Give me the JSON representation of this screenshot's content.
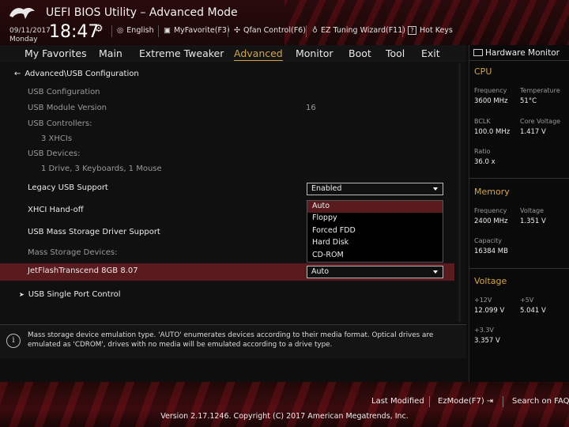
{
  "header": {
    "title": "UEFI BIOS Utility – Advanced Mode",
    "date": "09/11/2017",
    "day": "Monday",
    "time": "18:47",
    "tools": [
      {
        "label": "English",
        "icon": "globe-icon"
      },
      {
        "label": "MyFavorite(F3)",
        "icon": "favorite-icon"
      },
      {
        "label": "Qfan Control(F6)",
        "icon": "fan-icon"
      },
      {
        "label": "EZ Tuning Wizard(F11)",
        "icon": "bulb-icon"
      },
      {
        "label": "Hot Keys",
        "icon": "question-icon"
      }
    ]
  },
  "tabs": [
    {
      "label": "My Favorites"
    },
    {
      "label": "Main"
    },
    {
      "label": "Extreme Tweaker"
    },
    {
      "label": "Advanced",
      "active": true
    },
    {
      "label": "Monitor"
    },
    {
      "label": "Boot"
    },
    {
      "label": "Tool"
    },
    {
      "label": "Exit"
    }
  ],
  "breadcrumb": "Advanced\\USB Configuration",
  "main": {
    "usb_config": "USB Configuration",
    "module_version_label": "USB Module Version",
    "module_version_value": "16",
    "controllers_label": "USB Controllers:",
    "controllers_value": "3 XHCIs",
    "devices_label": "USB Devices:",
    "devices_value": "1 Drive, 3 Keyboards, 1 Mouse",
    "legacy_label": "Legacy USB Support",
    "legacy_value": "Enabled",
    "xhci_label": "XHCI Hand-off",
    "mass_driver_label": "USB Mass Storage Driver Support",
    "mass_devices_label": "Mass Storage Devices:",
    "jetflash_label": "JetFlashTranscend 8GB 8.07",
    "jetflash_value": "Auto",
    "single_port_label": "USB Single Port Control"
  },
  "popup_options": [
    "Auto",
    "Floppy",
    "Forced FDD",
    "Hard Disk",
    "CD-ROM"
  ],
  "info_text": "Mass storage device emulation type. 'AUTO' enumerates devices according to their media format. Optical drives are emulated as 'CDROM', drives with no media will be emulated according to a drive type.",
  "hardware_monitor": {
    "title": "Hardware Monitor",
    "cpu": {
      "title": "CPU",
      "frequency_label": "Frequency",
      "frequency_value": "3600 MHz",
      "temperature_label": "Temperature",
      "temperature_value": "51°C",
      "bclk_label": "BCLK",
      "bclk_value": "100.0 MHz",
      "core_voltage_label": "Core Voltage",
      "core_voltage_value": "1.417 V",
      "ratio_label": "Ratio",
      "ratio_value": "36.0 x"
    },
    "memory": {
      "title": "Memory",
      "frequency_label": "Frequency",
      "frequency_value": "2400 MHz",
      "voltage_label": "Voltage",
      "voltage_value": "1.351 V",
      "capacity_label": "Capacity",
      "capacity_value": "16384 MB"
    },
    "voltage": {
      "title": "Voltage",
      "v12_label": "+12V",
      "v12_value": "12.099 V",
      "v5_label": "+5V",
      "v5_value": "5.041 V",
      "v33_label": "+3.3V",
      "v33_value": "3.357 V"
    }
  },
  "footer": {
    "last_modified": "Last Modified",
    "ezmode": "EzMode(F7)",
    "search_faq": "Search on FAQ",
    "copyright": "Version 2.17.1246. Copyright (C) 2017 American Megatrends, Inc."
  },
  "colors": {
    "accent": "#d6a54a",
    "highlight": "#5a1b1e",
    "brand_red": "#b01822"
  }
}
